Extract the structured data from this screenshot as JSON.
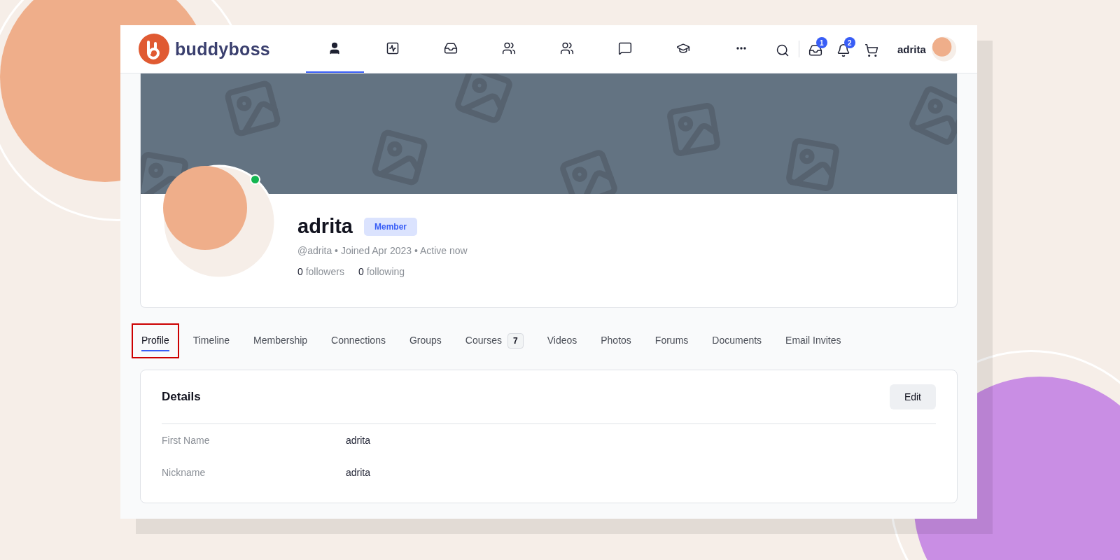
{
  "header": {
    "logo_text": "buddyboss",
    "nav": [
      {
        "kind": "user",
        "selected": true
      },
      {
        "kind": "activity",
        "selected": false
      },
      {
        "kind": "inbox",
        "selected": false
      },
      {
        "kind": "users",
        "selected": false
      },
      {
        "kind": "users",
        "selected": false
      },
      {
        "kind": "message",
        "selected": false
      },
      {
        "kind": "courses",
        "selected": false
      },
      {
        "kind": "more",
        "selected": false
      }
    ],
    "actions": [
      {
        "kind": "search"
      },
      {
        "kind": "divider"
      },
      {
        "kind": "inbox",
        "badge": "1"
      },
      {
        "kind": "bell",
        "badge": "2"
      },
      {
        "kind": "cart"
      }
    ],
    "username": "adrita"
  },
  "profile": {
    "name": "adrita",
    "role": "Member",
    "online": true,
    "meta": "@adrita • Joined Apr 2023 • Active now",
    "stats": [
      {
        "count": "0",
        "label": "followers"
      },
      {
        "count": "0",
        "label": "following"
      }
    ]
  },
  "tabs": [
    {
      "label": "Profile",
      "selected": true,
      "highlighted": true
    },
    {
      "label": "Timeline",
      "selected": false,
      "highlighted": false
    },
    {
      "label": "Membership",
      "selected": false,
      "highlighted": false
    },
    {
      "label": "Connections",
      "selected": false,
      "highlighted": false
    },
    {
      "label": "Groups",
      "selected": false,
      "highlighted": false
    },
    {
      "label": "Courses",
      "selected": false,
      "highlighted": false,
      "count": "7"
    },
    {
      "label": "Videos",
      "selected": false,
      "highlighted": false
    },
    {
      "label": "Photos",
      "selected": false,
      "highlighted": false
    },
    {
      "label": "Forums",
      "selected": false,
      "highlighted": false
    },
    {
      "label": "Documents",
      "selected": false,
      "highlighted": false
    },
    {
      "label": "Email Invites",
      "selected": false,
      "highlighted": false
    }
  ],
  "details": {
    "title": "Details",
    "edit_button": "Edit",
    "fields": [
      {
        "label": "First Name",
        "value": "adrita"
      },
      {
        "label": "Nickname",
        "value": "adrita"
      }
    ]
  }
}
